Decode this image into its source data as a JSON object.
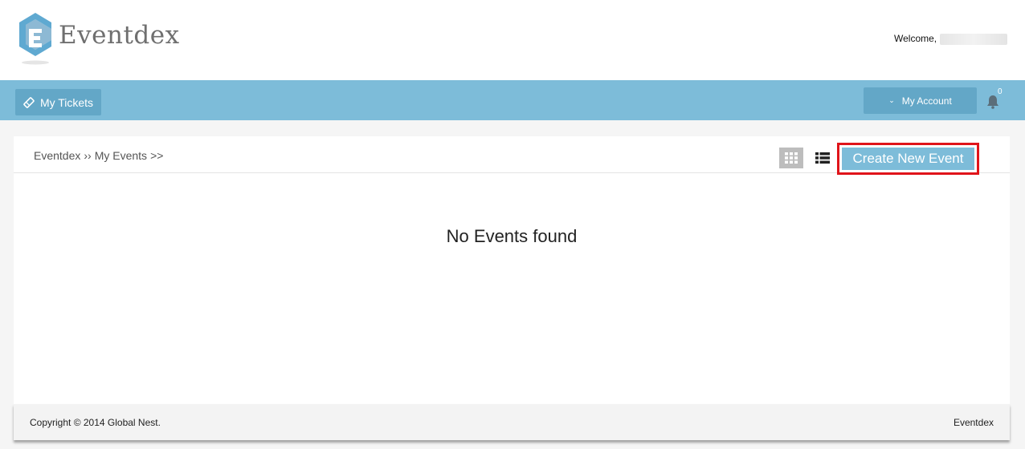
{
  "header": {
    "brand": "Eventdex",
    "welcome_label": "Welcome,"
  },
  "navbar": {
    "tickets_label": "My Tickets",
    "account_label": "My Account",
    "notification_count": "0"
  },
  "breadcrumb": {
    "root": "Eventdex",
    "sep1": "››",
    "current": "My Events",
    "sep2": ">>"
  },
  "toolbar": {
    "create_label": "Create New Event"
  },
  "main": {
    "empty_message": "No Events found"
  },
  "footer": {
    "copyright": "Copyright © 2014 Global Nest.",
    "brand": "Eventdex"
  },
  "colors": {
    "navbar": "#7dbcd9",
    "highlight": "#e0141a"
  },
  "icons": [
    "eventdex-logo-icon",
    "ticket-icon",
    "chevron-down-icon",
    "bell-icon",
    "grid-view-icon",
    "list-view-icon"
  ]
}
